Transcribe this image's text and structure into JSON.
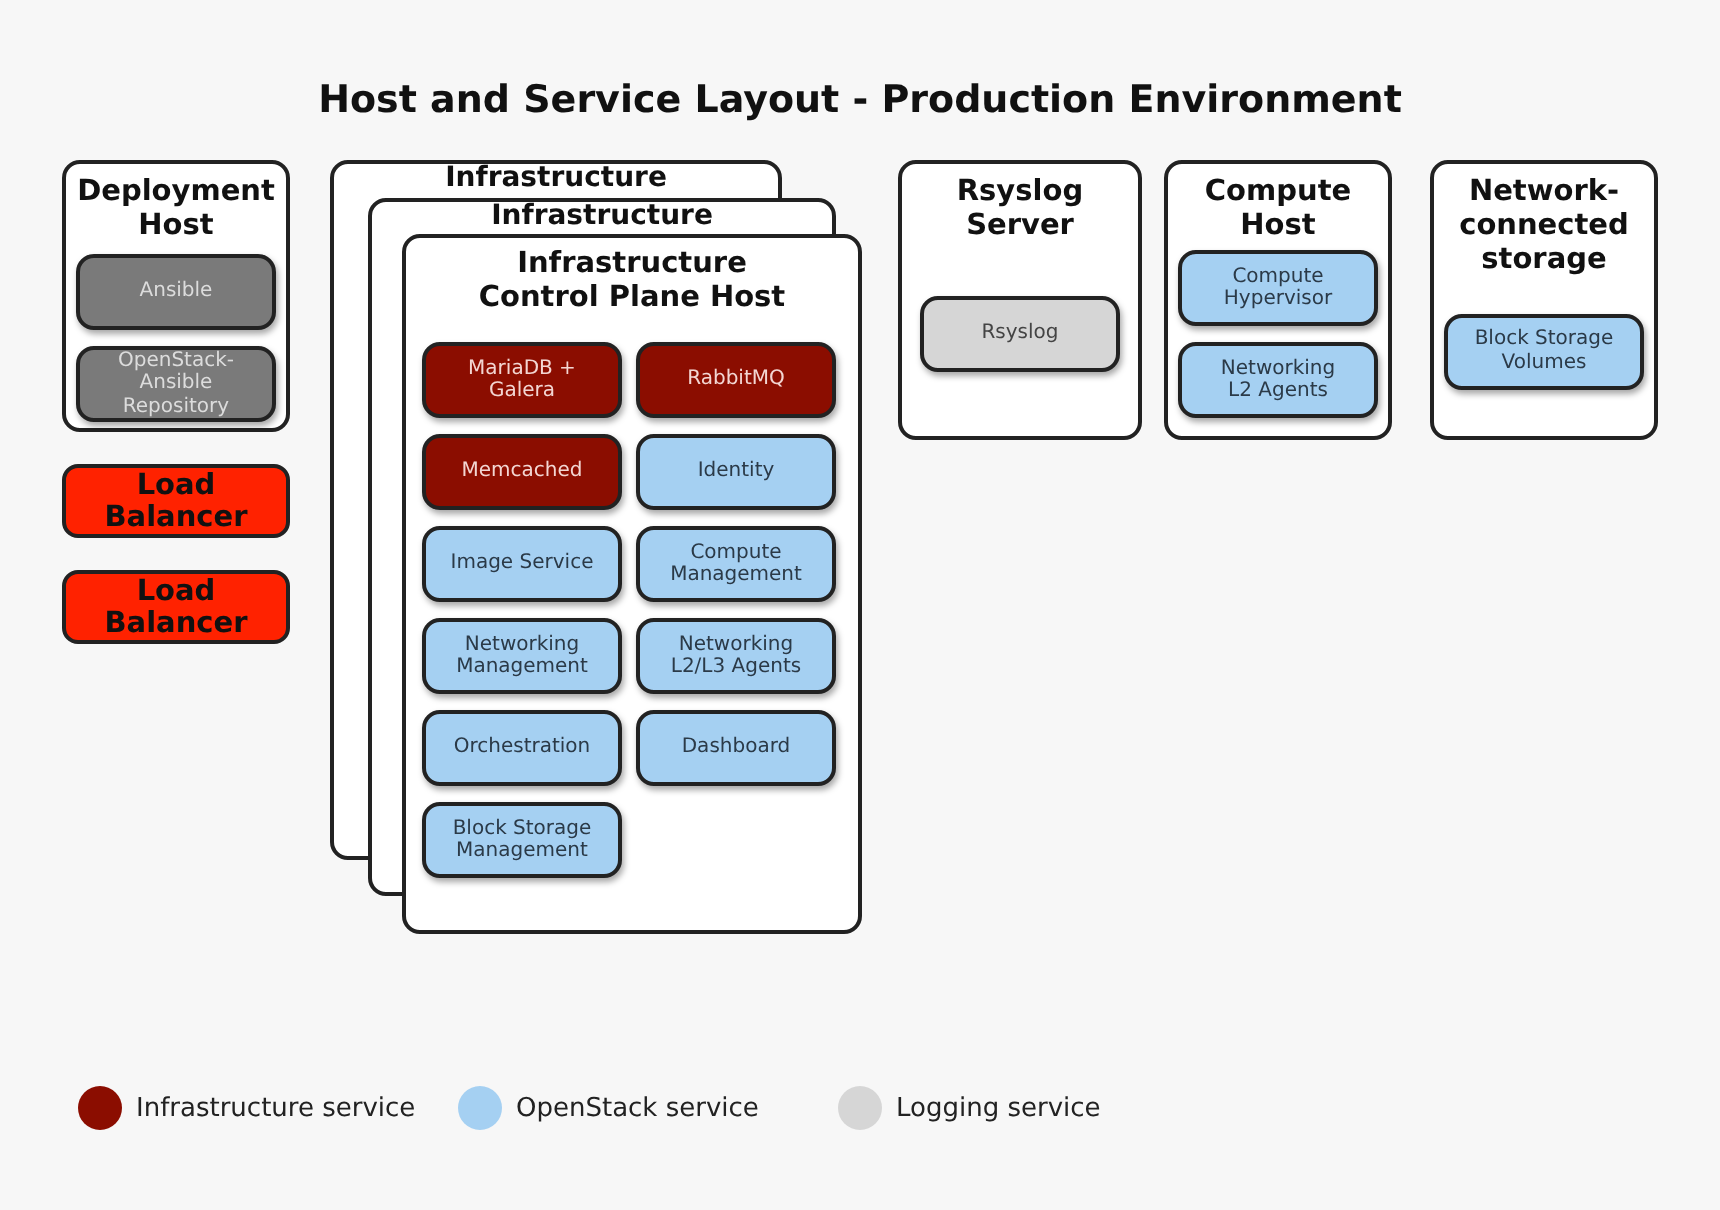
{
  "title": "Host and Service Layout - Production Environment",
  "deployment_host": {
    "title": "Deployment\nHost",
    "services": [
      {
        "label": "Ansible",
        "kind": "tool"
      },
      {
        "label": "OpenStack-\nAnsible\nRepository",
        "kind": "tool"
      }
    ]
  },
  "load_balancers": [
    {
      "label": "Load\nBalancer"
    },
    {
      "label": "Load\nBalancer"
    }
  ],
  "infrastructure_host": {
    "stacked_titles": [
      "Infrastructure",
      "Infrastructure"
    ],
    "title": "Infrastructure\nControl Plane Host",
    "services": [
      {
        "label": "MariaDB +\nGalera",
        "kind": "infrastructure"
      },
      {
        "label": "RabbitMQ",
        "kind": "infrastructure"
      },
      {
        "label": "Memcached",
        "kind": "infrastructure"
      },
      {
        "label": "Identity",
        "kind": "openstack"
      },
      {
        "label": "Image Service",
        "kind": "openstack"
      },
      {
        "label": "Compute\nManagement",
        "kind": "openstack"
      },
      {
        "label": "Networking\nManagement",
        "kind": "openstack"
      },
      {
        "label": "Networking\nL2/L3 Agents",
        "kind": "openstack"
      },
      {
        "label": "Orchestration",
        "kind": "openstack"
      },
      {
        "label": "Dashboard",
        "kind": "openstack"
      },
      {
        "label": "Block Storage\nManagement",
        "kind": "openstack"
      }
    ]
  },
  "hosts": [
    {
      "title": "Rsyslog\nServer",
      "services": [
        {
          "label": "Rsyslog",
          "kind": "logging"
        }
      ]
    },
    {
      "title": "Compute\nHost",
      "services": [
        {
          "label": "Compute\nHypervisor",
          "kind": "openstack"
        },
        {
          "label": "Networking\nL2 Agents",
          "kind": "openstack"
        }
      ]
    },
    {
      "title": "Network-\nconnected\nstorage",
      "services": [
        {
          "label": "Block Storage\nVolumes",
          "kind": "openstack"
        }
      ]
    }
  ],
  "legend": [
    {
      "label": "Infrastructure service",
      "color": "#8b0d00"
    },
    {
      "label": "OpenStack service",
      "color": "#a5d0f2"
    },
    {
      "label": "Logging service",
      "color": "#d6d6d6"
    }
  ]
}
